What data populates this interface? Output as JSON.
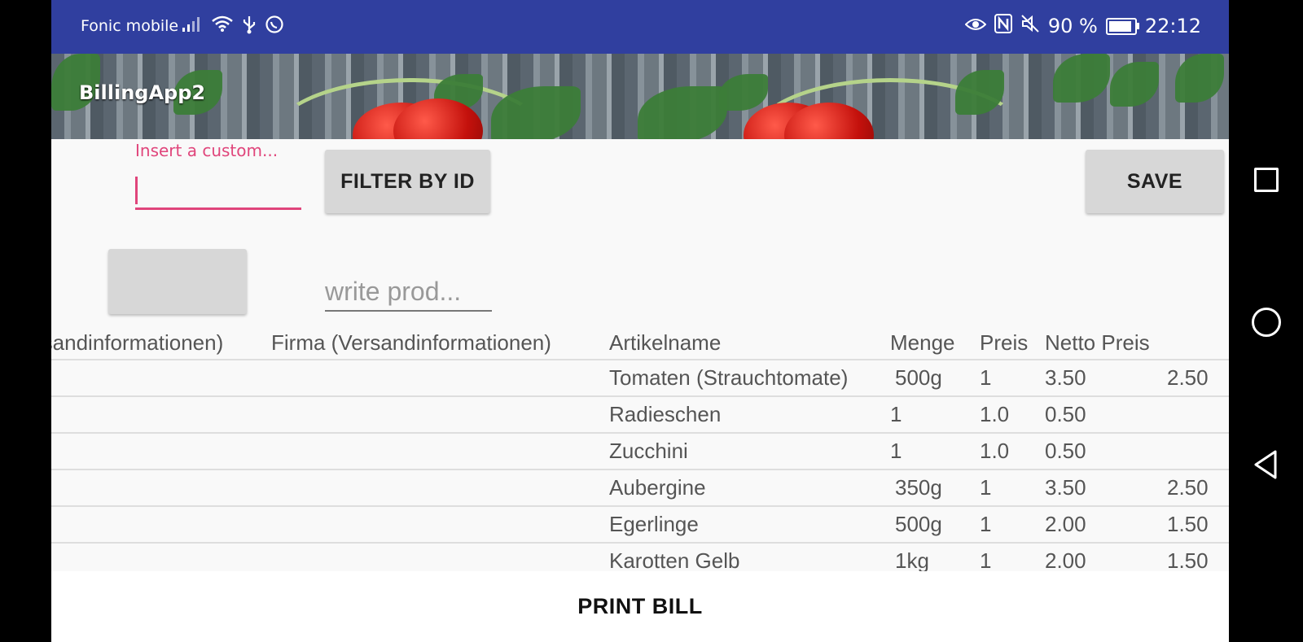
{
  "status_bar": {
    "carrier": "Fonic mobile",
    "battery": "90 %",
    "battery_level": 0.9,
    "time": "22:12",
    "icons": [
      "signal-icon",
      "wifi-icon",
      "usb-icon",
      "whatsapp-icon",
      "eye-icon",
      "nfc-icon",
      "mute-icon",
      "battery-icon"
    ]
  },
  "app": {
    "title": "BillingApp2"
  },
  "customer_input": {
    "label": "Insert a custom...",
    "value": ""
  },
  "buttons": {
    "filter": "FILTER BY ID",
    "save": "SAVE",
    "blank": "",
    "print": "PRINT BILL"
  },
  "product_input": {
    "placeholder": "write prod..."
  },
  "table": {
    "headers": [
      "rsandinformationen)",
      "Firma (Versandinformationen)",
      "Artikelname",
      "Menge",
      "Preis",
      "Netto Preis",
      ""
    ],
    "rows": [
      [
        "",
        "",
        "Tomaten (Strauchtomate)",
        "500g",
        "1",
        "3.50",
        "2.50"
      ],
      [
        "",
        "",
        "Radieschen",
        "1",
        "1.0",
        "0.50",
        ""
      ],
      [
        "",
        "",
        "Zucchini",
        "1",
        "1.0",
        "0.50",
        ""
      ],
      [
        "",
        "",
        "Aubergine",
        "350g",
        "1",
        "3.50",
        "2.50"
      ],
      [
        "",
        "",
        "Egerlinge",
        "500g",
        "1",
        "2.00",
        "1.50"
      ],
      [
        "",
        "",
        "Karotten Gelb",
        "1kg",
        "1",
        "2.00",
        "1.50"
      ]
    ]
  }
}
